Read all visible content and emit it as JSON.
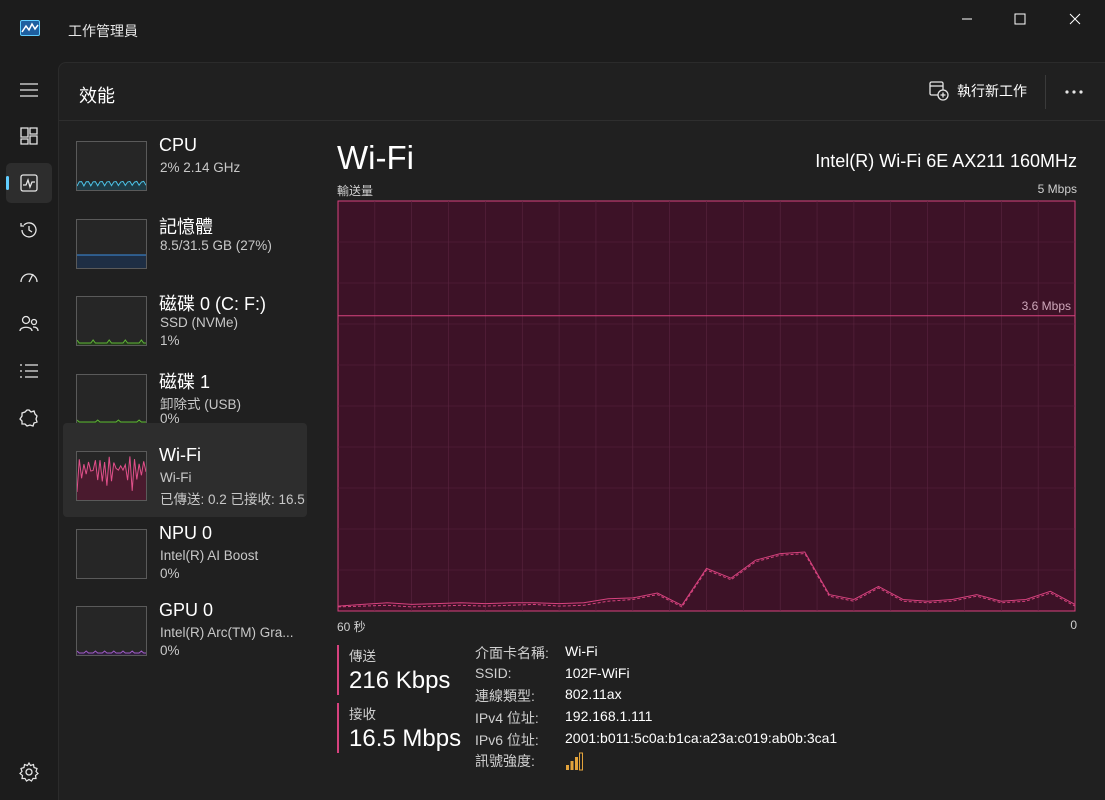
{
  "window": {
    "title": "工作管理員",
    "controls": [
      "minimize-icon",
      "maximize-icon",
      "close-icon"
    ]
  },
  "nav": {
    "items": [
      {
        "name": "hamburger-menu-icon"
      },
      {
        "name": "processes-icon"
      },
      {
        "name": "performance-icon",
        "active": true
      },
      {
        "name": "app-history-icon"
      },
      {
        "name": "startup-apps-icon"
      },
      {
        "name": "users-icon"
      },
      {
        "name": "details-icon"
      },
      {
        "name": "services-icon"
      }
    ],
    "settings_icon": "gear-icon"
  },
  "header": {
    "title": "效能",
    "run_task_label": "執行新工作",
    "more_icon": "more-icon"
  },
  "devices": [
    {
      "id": "cpu",
      "title": "CPU",
      "line1": "2%  2.14 GHz",
      "line2": "",
      "color": "#4cc2e6",
      "fill": "#1e3a44"
    },
    {
      "id": "memory",
      "title": "記憶體",
      "line1": "8.5/31.5 GB (27%)",
      "line2": "",
      "color": "#3c8fe0",
      "fill": "#1e2e44"
    },
    {
      "id": "disk0",
      "title": "磁碟 0 (C: F:)",
      "line1": "SSD (NVMe)",
      "line2": "1%",
      "color": "#5fb536",
      "fill": "#243a1c"
    },
    {
      "id": "disk1",
      "title": "磁碟 1",
      "line1": "卸除式 (USB)",
      "line2": "0%",
      "color": "#5fb536",
      "fill": "#243a1c"
    },
    {
      "id": "wifi",
      "title": "Wi-Fi",
      "line1": "Wi-Fi",
      "line2": "已傳送: 0.2 已接收: 16.5",
      "color": "#e0508a",
      "fill": "#4a1a2e",
      "selected": true
    },
    {
      "id": "npu0",
      "title": "NPU 0",
      "line1": "Intel(R) AI Boost",
      "line2": "0%",
      "color": "#8b8b8b",
      "fill": "#2a2a2a"
    },
    {
      "id": "gpu0",
      "title": "GPU 0",
      "line1": "Intel(R) Arc(TM) Gra...",
      "line2": "0%",
      "color": "#a05cc8",
      "fill": "#2e1f3a"
    }
  ],
  "detail": {
    "title": "Wi-Fi",
    "adapter": "Intel(R) Wi-Fi 6E AX211 160MHz",
    "graph_label": "輸送量",
    "graph_max": "5 Mbps",
    "ref_line_label": "3.6 Mbps",
    "time_left": "60 秒",
    "time_right": "0",
    "send_label": "傳送",
    "send_value": "216 Kbps",
    "recv_label": "接收",
    "recv_value": "16.5 Mbps",
    "properties": [
      {
        "key": "介面卡名稱:",
        "value": "Wi-Fi"
      },
      {
        "key": "SSID:",
        "value": "102F-WiFi"
      },
      {
        "key": "連線類型:",
        "value": "802.11ax"
      },
      {
        "key": "IPv4 位址:",
        "value": "192.168.1.111"
      },
      {
        "key": "IPv6 位址:",
        "value": "2001:b011:5c0a:b1ca:a23a:c019:ab0b:3ca1"
      },
      {
        "key": "訊號強度:",
        "value": ""
      }
    ],
    "signal_icon": "signal-strength-icon"
  },
  "colors": {
    "accent": "#60cdff",
    "wifi_line": "#d6427e",
    "wifi_fill": "#3d1227",
    "wifi_grid": "#5a2540",
    "signal": "#e3a33b"
  },
  "chart_data": {
    "type": "line",
    "title": "",
    "ylabel": "輸送量",
    "ylim": [
      0,
      5
    ],
    "x": [
      60,
      58,
      56,
      54,
      52,
      50,
      48,
      46,
      44,
      42,
      40,
      38,
      36,
      34,
      32,
      30,
      28,
      26,
      24,
      22,
      20,
      18,
      16,
      14,
      12,
      10,
      8,
      6,
      4,
      2,
      0
    ],
    "series": [
      {
        "name": "",
        "values": [
          0.05,
          0.06,
          0.07,
          0.05,
          0.06,
          0.07,
          0.06,
          0.07,
          0.08,
          0.06,
          0.07,
          0.12,
          0.14,
          0.2,
          0.05,
          0.5,
          0.38,
          0.6,
          0.68,
          0.7,
          0.18,
          0.12,
          0.28,
          0.12,
          0.1,
          0.12,
          0.18,
          0.1,
          0.12,
          0.22,
          0.06
        ]
      },
      {
        "name": "",
        "values": [
          0.06,
          0.08,
          0.1,
          0.08,
          0.09,
          0.1,
          0.09,
          0.1,
          0.1,
          0.09,
          0.1,
          0.15,
          0.16,
          0.22,
          0.07,
          0.52,
          0.4,
          0.62,
          0.7,
          0.72,
          0.2,
          0.14,
          0.3,
          0.14,
          0.12,
          0.14,
          0.2,
          0.12,
          0.14,
          0.24,
          0.08
        ]
      }
    ],
    "ref_line": 3.6,
    "grid": true
  }
}
